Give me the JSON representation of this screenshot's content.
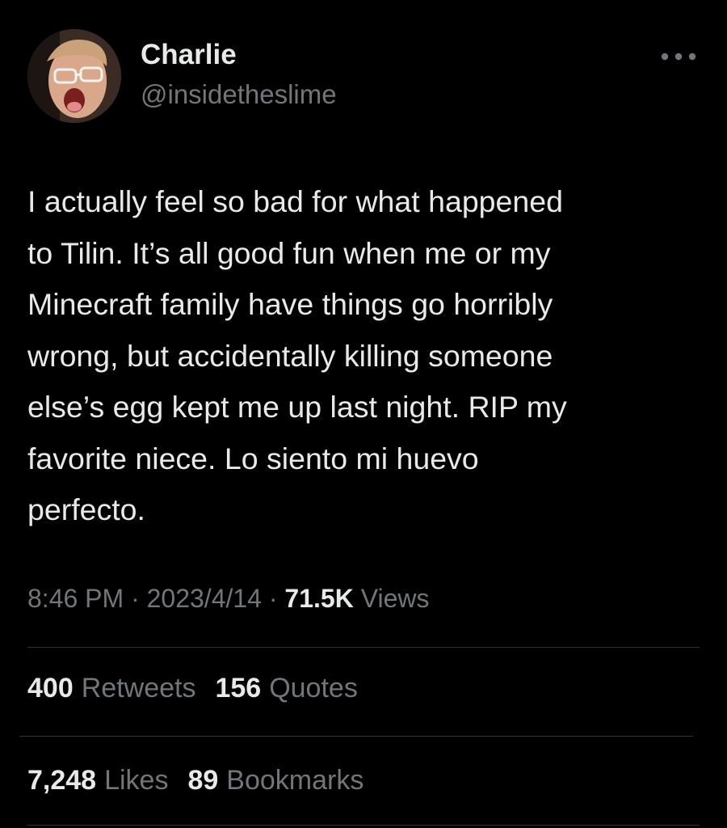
{
  "tweet": {
    "display_name": "Charlie",
    "handle": "@insidetheslime",
    "more_icon": "more-horizontal-icon",
    "text_lines": [
      "I actually feel so bad for what happened",
      "to Tilin. It’s all good fun when me or my",
      "Minecraft family have things go horribly",
      "wrong, but accidentally killing someone",
      "else’s egg kept me up last night. RIP my",
      "favorite niece. Lo siento mi huevo",
      "perfecto."
    ],
    "time": "8:46 PM",
    "separator": "·",
    "date": "2023/4/14",
    "views_count": "71.5K",
    "views_label": "Views",
    "retweets_count": "400",
    "retweets_label": "Retweets",
    "quotes_count": "156",
    "quotes_label": "Quotes",
    "likes_count": "7,248",
    "likes_label": "Likes",
    "bookmarks_count": "89",
    "bookmarks_label": "Bookmarks"
  },
  "colors": {
    "background": "#000000",
    "primary_text": "#e7e9ea",
    "secondary_text": "#71767b",
    "divider": "#2f3336"
  }
}
